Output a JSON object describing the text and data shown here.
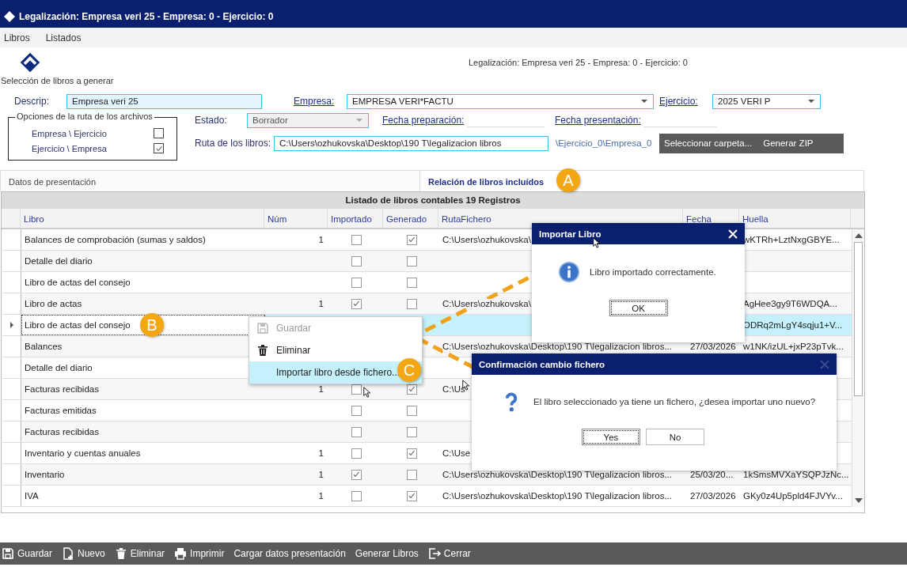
{
  "window": {
    "title": "Legalización: Empresa veri 25 - Empresa: 0 - Ejercicio: 0"
  },
  "menu": [
    "Libros",
    "Listados"
  ],
  "header": {
    "caption": "Legalización: Empresa veri 25 - Empresa: 0 - Ejercicio: 0",
    "section": "Selección de libros a generar"
  },
  "form": {
    "descrip_label": "Descrip:",
    "descrip": "Empresa veri 25",
    "empresa_label": "Empresa:",
    "empresa": "EMPRESA VERI*FACTU",
    "ejercicio_label": "Ejercicio:",
    "ejercicio": "2025 VERI P",
    "estado_label": "Estado:",
    "estado": "Borrador",
    "fecha_preparacion_label": "Fecha preparación:",
    "fecha_presentacion_label": "Fecha presentación:",
    "ruta_label": "Ruta de los libros:",
    "ruta": "C:\\Users\\ozhukovska\\Desktop\\190 T\\legalizacion libros",
    "ruta_suffix": "\\Ejercicio_0\\Empresa_0"
  },
  "path_options": {
    "title": "Opciones de la ruta de los archivos",
    "items": [
      {
        "label": "Empresa \\ Ejercicio",
        "checked": false
      },
      {
        "label": "Ejercicio \\ Empresa",
        "checked": true
      }
    ]
  },
  "folder_buttons": [
    "Seleccionar carpeta...",
    "Generar ZIP"
  ],
  "tabs": [
    {
      "label": "Datos de presentación",
      "selected": false
    },
    {
      "label": "Relación de libros incluídos",
      "selected": true
    }
  ],
  "table": {
    "title": "Listado de libros contables 19 Registros",
    "columns": [
      "Libro",
      "Núm",
      "Importado",
      "Generado",
      "RutaFichero",
      "Fecha",
      "Huella"
    ],
    "rows": [
      {
        "libro": "Balances de comprobación (sumas y saldos)",
        "num": "1",
        "importado": false,
        "generado": true,
        "ruta": "C:\\Users\\ozhukovska\\",
        "huella": "wKTRh+LztNxgGBYE...",
        "current": false,
        "selected": false
      },
      {
        "libro": "Detalle del diario",
        "importado": false,
        "generado": false,
        "current": false,
        "selected": false
      },
      {
        "libro": "Libro de actas del consejo",
        "importado": false,
        "generado": false,
        "current": false,
        "selected": false
      },
      {
        "libro": "Libro de actas",
        "num": "1",
        "importado": true,
        "generado": false,
        "ruta": "C:\\Users\\ozhukovska\\",
        "huella": "AgHee3gy9T6WDQA...",
        "current": false,
        "selected": false
      },
      {
        "libro": "Libro de actas del consejo",
        "huella": "ODRq2mLgY4sqju1+V...",
        "current": true,
        "selected": true
      },
      {
        "libro": "Balances",
        "ruta": "C:\\Users\\ozhukovska\\Desktop\\190 T\\legalizacion libros...",
        "fecha": "27/03/2026",
        "huella": "w1NK/izUL+jxP23pTvk...",
        "current": false,
        "selected": false
      },
      {
        "libro": "Detalle del diario",
        "current": false,
        "selected": false
      },
      {
        "libro": "Facturas recibidas",
        "num": "1",
        "importado": false,
        "generado": true,
        "ruta": "C:\\Us",
        "current": false,
        "selected": false
      },
      {
        "libro": "Facturas emitidas",
        "importado": false,
        "generado": false,
        "current": false,
        "selected": false
      },
      {
        "libro": "Facturas recibidas",
        "importado": false,
        "generado": false,
        "current": false,
        "selected": false
      },
      {
        "libro": "Inventario y cuentas anuales",
        "num": "1",
        "importado": false,
        "generado": true,
        "ruta": "C:\\Use",
        "current": false,
        "selected": false
      },
      {
        "libro": "Inventario",
        "num": "1",
        "importado": true,
        "generado": false,
        "ruta": "C:\\Users\\ozhukovska\\Desktop\\190 T\\legalizacion libros...",
        "fecha": "25/03/20...",
        "huella": "1kSmsMVXaYSQPJzNc...",
        "current": false,
        "selected": false
      },
      {
        "libro": "IVA",
        "num": "1",
        "importado": false,
        "generado": true,
        "ruta": "C:\\Users\\ozhukovska\\Desktop\\190 T\\legalizacion libros...",
        "fecha": "27/03/2026",
        "huella": "GKy0z4Up5pld4FJVYv...",
        "current": false,
        "selected": false
      }
    ]
  },
  "context_menu": [
    {
      "label": "Guardar",
      "kind": "save",
      "disabled": true,
      "selected": false
    },
    {
      "label": "Eliminar",
      "kind": "trash",
      "disabled": false,
      "selected": false
    },
    {
      "label": "Importar libro desde fichero...",
      "disabled": false,
      "selected": true
    }
  ],
  "dialogs": [
    {
      "title": "Importar Libro",
      "kind": "info",
      "message": "Libro importado correctamente.",
      "close_disabled": false,
      "buttons": [
        {
          "label": "OK",
          "focused": true
        }
      ]
    },
    {
      "title": "Confirmación cambio fichero",
      "kind": "question",
      "message": "El libro seleccionado ya tiene un fichero, ¿desea importar uno nuevo?",
      "close_disabled": true,
      "buttons": [
        {
          "label": "Yes",
          "focused": true
        },
        {
          "label": "No",
          "focused": false
        }
      ]
    }
  ],
  "callouts": [
    "A",
    "B",
    "C"
  ],
  "toolbar": [
    {
      "label": "Guardar",
      "kind": "save"
    },
    {
      "label": "Nuevo",
      "kind": "new"
    },
    {
      "label": "Eliminar",
      "kind": "trash"
    },
    {
      "label": "Imprimir",
      "kind": "print"
    },
    {
      "label": "Cargar datos presentación",
      "kind": "text"
    },
    {
      "label": "Generar Libros",
      "kind": "text"
    },
    {
      "label": "Cerrar",
      "kind": "exit"
    }
  ]
}
